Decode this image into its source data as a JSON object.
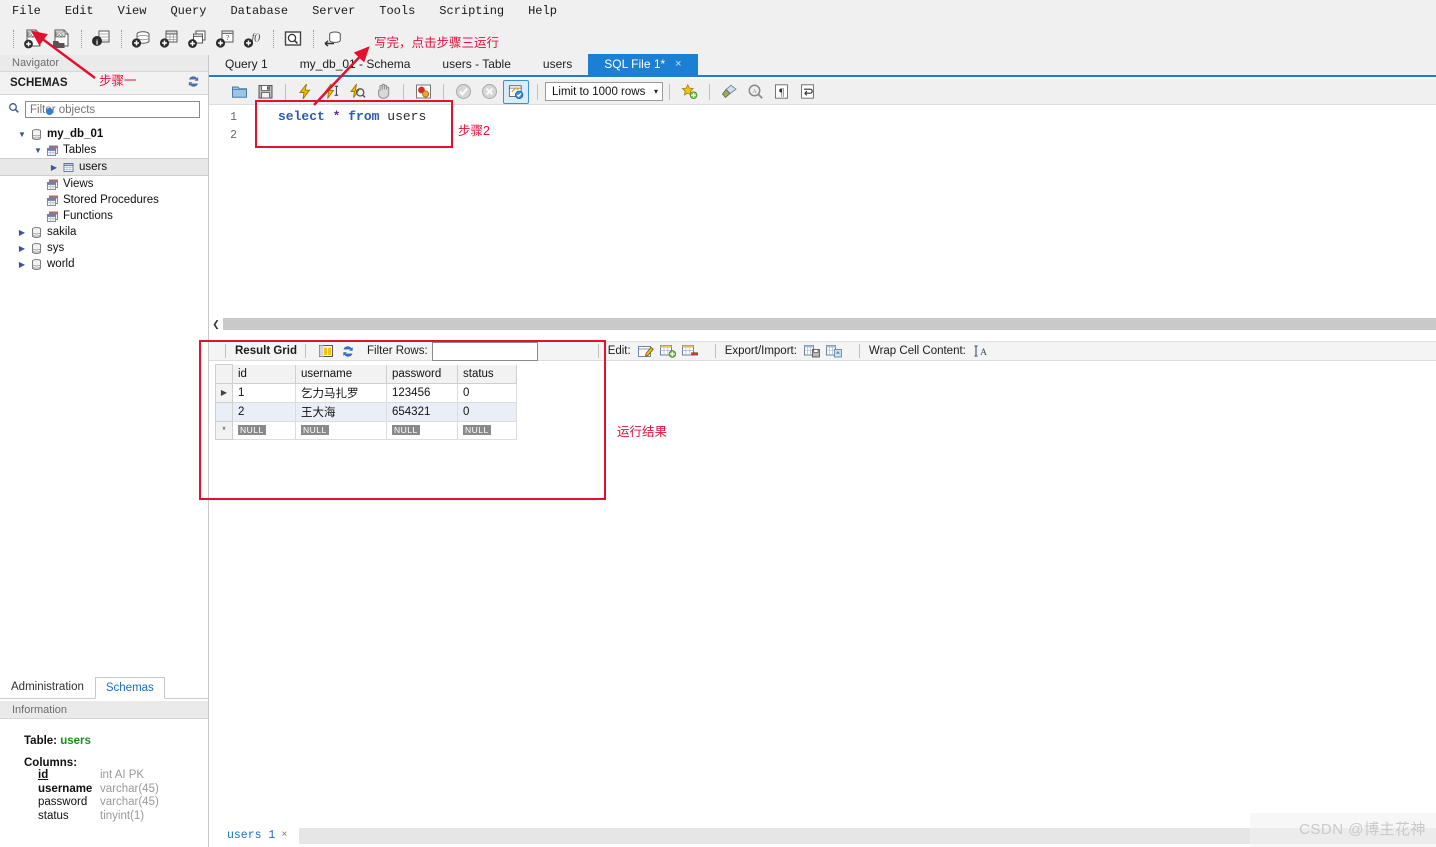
{
  "menu": {
    "items": [
      "File",
      "Edit",
      "View",
      "Query",
      "Database",
      "Server",
      "Tools",
      "Scripting",
      "Help"
    ]
  },
  "main_toolbar": {
    "buttons": [
      {
        "name": "new-sql-tab-icon",
        "title": "New SQL Tab"
      },
      {
        "name": "open-sql-script-icon",
        "title": "Open SQL Script"
      },
      {
        "name": "inspector-icon",
        "title": "Server Inspector"
      },
      {
        "name": "create-schema-icon",
        "title": "Create New Schema"
      },
      {
        "name": "create-table-icon",
        "title": "Create New Table"
      },
      {
        "name": "create-view-icon",
        "title": "Create New View"
      },
      {
        "name": "create-procedure-icon",
        "title": "Create New Stored Procedure"
      },
      {
        "name": "create-function-icon",
        "title": "Create New Function"
      },
      {
        "name": "search-data-icon",
        "title": "Search Table Data"
      },
      {
        "name": "reconnect-server-icon",
        "title": "Reconnect to DBMS"
      }
    ]
  },
  "sidebar": {
    "navigator_label": "Navigator",
    "schemas_label": "SCHEMAS",
    "refresh_icon": "refresh-icon",
    "filter": {
      "placeholder": "Filter objects",
      "value": ""
    },
    "tree": [
      {
        "label": "my_db_01",
        "level": 0,
        "expanded": true,
        "bold": true,
        "icon": "schema-icon",
        "selected": false
      },
      {
        "label": "Tables",
        "level": 1,
        "expanded": true,
        "bold": false,
        "icon": "folder-tables-icon",
        "selected": false
      },
      {
        "label": "users",
        "level": 2,
        "expanded": false,
        "bold": false,
        "icon": "table-icon",
        "selected": true
      },
      {
        "label": "Views",
        "level": 1,
        "expanded": null,
        "bold": false,
        "icon": "folder-views-icon",
        "selected": false
      },
      {
        "label": "Stored Procedures",
        "level": 1,
        "expanded": null,
        "bold": false,
        "icon": "folder-procs-icon",
        "selected": false
      },
      {
        "label": "Functions",
        "level": 1,
        "expanded": null,
        "bold": false,
        "icon": "folder-funcs-icon",
        "selected": false
      },
      {
        "label": "sakila",
        "level": 0,
        "expanded": false,
        "bold": false,
        "icon": "schema-icon",
        "selected": false
      },
      {
        "label": "sys",
        "level": 0,
        "expanded": false,
        "bold": false,
        "icon": "schema-icon",
        "selected": false
      },
      {
        "label": "world",
        "level": 0,
        "expanded": false,
        "bold": false,
        "icon": "schema-icon",
        "selected": false
      }
    ],
    "tabs": [
      {
        "label": "Administration",
        "active": false
      },
      {
        "label": "Schemas",
        "active": true
      }
    ],
    "information_label": "Information",
    "info": {
      "table_label": "Table:",
      "table_name": "users",
      "columns_label": "Columns:",
      "columns": [
        {
          "name": "id",
          "type": "int AI PK",
          "style": "pk"
        },
        {
          "name": "username",
          "type": "varchar(45)",
          "style": "bold"
        },
        {
          "name": "password",
          "type": "varchar(45)",
          "style": "normal"
        },
        {
          "name": "status",
          "type": "tinyint(1)",
          "style": "normal"
        }
      ]
    }
  },
  "editor_tabs": [
    {
      "label": "Query 1",
      "active": false,
      "closable": false
    },
    {
      "label": "my_db_01 - Schema",
      "active": false,
      "closable": false
    },
    {
      "label": "users - Table",
      "active": false,
      "closable": false
    },
    {
      "label": "users",
      "active": false,
      "closable": false
    },
    {
      "label": "SQL File 1*",
      "active": true,
      "closable": true,
      "close_glyph": "×"
    }
  ],
  "editor_toolbar": {
    "buttons": [
      {
        "name": "open-file-icon",
        "title": "Open a script file"
      },
      {
        "name": "save-file-icon",
        "title": "Save script"
      },
      {
        "name": "execute-statement-icon",
        "title": "Execute the selected portion"
      },
      {
        "name": "execute-current-statement-icon",
        "title": "Execute current statement"
      },
      {
        "name": "explain-statement-icon",
        "title": "Explain current statement"
      },
      {
        "name": "stop-statement-icon",
        "title": "Stop the query"
      },
      {
        "name": "toggle-breakpoint-icon",
        "title": "Toggle breakpoint"
      },
      {
        "name": "commit-icon",
        "title": "Commit transaction"
      },
      {
        "name": "rollback-icon",
        "title": "Rollback transaction"
      },
      {
        "name": "autocommit-toggle-icon",
        "title": "Toggle auto-commit mode"
      },
      {
        "name": "beautify-sql-icon",
        "title": "Beautify/reformat SQL"
      },
      {
        "name": "clear-context-icon",
        "title": "Clear context"
      },
      {
        "name": "find-icon",
        "title": "Find"
      },
      {
        "name": "invisible-chars-icon",
        "title": "Show invisible characters"
      },
      {
        "name": "wrap-lines-icon",
        "title": "Toggle word wrap"
      }
    ],
    "limit_select": {
      "value": "Limit to 1000 rows",
      "caret": "▾"
    }
  },
  "sql_editor": {
    "line_numbers": [
      "1",
      "2"
    ],
    "statement": {
      "keyword1": "select",
      "operator": "*",
      "keyword2": "from",
      "identifier": "users"
    },
    "full_text": "select * from users"
  },
  "result_toolbar": {
    "result_grid_label": "Result Grid",
    "grid_view_icon": "grid-view-icon",
    "refresh_icon": "refresh-grid-icon",
    "filter_rows_label": "Filter Rows:",
    "filter_rows_value": "",
    "edit_label": "Edit:",
    "edit_icons": [
      "edit-row-icon",
      "insert-row-icon",
      "delete-row-icon"
    ],
    "export_import_label": "Export/Import:",
    "export_import_icons": [
      "export-recordset-icon",
      "import-recordset-icon"
    ],
    "wrap_cell_label": "Wrap Cell Content:",
    "wrap_cell_icon": "wrap-cell-icon"
  },
  "result_grid": {
    "columns": [
      "id",
      "username",
      "password",
      "status"
    ],
    "rows": [
      {
        "marker": "▶",
        "cells": [
          "1",
          "乞力马扎罗",
          "123456",
          "0"
        ]
      },
      {
        "marker": "",
        "cells": [
          "2",
          "王大海",
          "654321",
          "0"
        ]
      }
    ],
    "placeholder_row": {
      "marker": "*",
      "cells": [
        "NULL",
        "NULL",
        "NULL",
        "NULL"
      ]
    }
  },
  "bottom_tabs": [
    {
      "label": "users 1",
      "close_glyph": "×"
    }
  ],
  "annotations": [
    {
      "name": "annotation-step-one",
      "text": "步骤一"
    },
    {
      "name": "annotation-write-then-run",
      "text": "写完，点击步骤三运行"
    },
    {
      "name": "annotation-step-two",
      "text": "步骤2"
    },
    {
      "name": "annotation-run-result",
      "text": "运行结果"
    }
  ],
  "watermark": {
    "text": "CSDN @博主花神"
  },
  "colors": {
    "accent_blue": "#1b7fd4",
    "annotation_red": "#e50f2f",
    "toolbar_bg": "#f0f0f0",
    "selected_row_blue": "#eaeff7",
    "green_table_name": "#1e8a1e"
  }
}
